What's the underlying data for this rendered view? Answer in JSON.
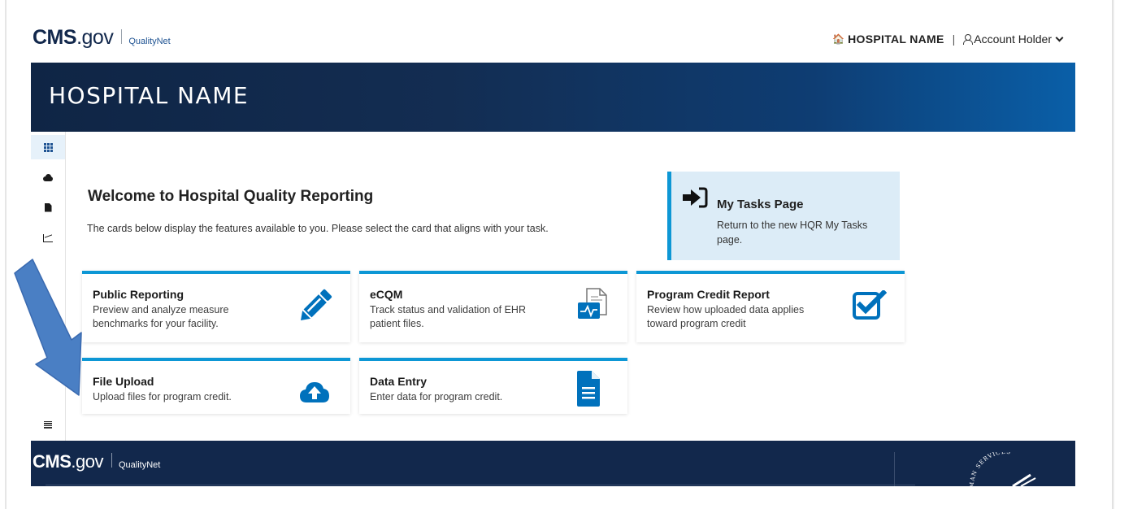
{
  "header": {
    "logo_cms": "CMS",
    "logo_gov": ".gov",
    "logo_sub": "QualityNet",
    "hospital": "HOSPITAL NAME",
    "separator": "|",
    "account": "Account Holder"
  },
  "banner": {
    "title": "HOSPITAL NAME"
  },
  "sidebar": {
    "items": [
      {
        "icon": "grid-icon",
        "active": true
      },
      {
        "icon": "cloud-upload-icon"
      },
      {
        "icon": "file-icon"
      },
      {
        "icon": "chart-icon"
      }
    ],
    "collapse_icon": "outdent-icon"
  },
  "welcome": {
    "title": "Welcome to Hospital Quality Reporting",
    "text": "The cards below display the features available to you. Please select the card that aligns with your task."
  },
  "tasks": {
    "title": "My Tasks Page",
    "text": "Return to the new HQR My Tasks page."
  },
  "cards": [
    {
      "title": "Public Reporting",
      "desc": "Preview and analyze measure benchmarks for your facility.",
      "icon": "pencil-icon"
    },
    {
      "title": "eCQM",
      "desc": "Track status and validation of EHR patient files.",
      "icon": "ehr-file-icon"
    },
    {
      "title": "Program Credit Report",
      "desc": "Review how uploaded data applies toward program credit",
      "icon": "checkbox-icon"
    },
    {
      "title": "File Upload",
      "desc": "Upload files for program credit.",
      "icon": "cloud-upload-icon"
    },
    {
      "title": "Data Entry",
      "desc": "Enter data for program credit.",
      "icon": "document-icon"
    }
  ],
  "footer": {
    "logo_cms": "CMS",
    "logo_gov": ".gov",
    "logo_sub": "QualityNet",
    "seal_text": "MAN SERVICES"
  },
  "colors": {
    "navy": "#12284c",
    "accent": "#0d97d5",
    "icon_blue": "#0071bc",
    "tasks_bg": "#dcecf7",
    "arrow": "#4a7fc4"
  }
}
